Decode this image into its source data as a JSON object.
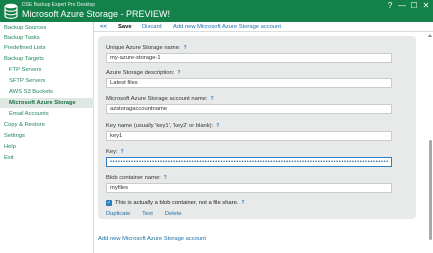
{
  "titlebar": {
    "app_name": "DSE Backup Expert Pro Desktop",
    "page_heading": "Microsoft Azure Storage - PREVIEW!",
    "help_button": "?",
    "minimize_button": "—",
    "maximize_button": "☐",
    "close_button": "✕",
    "accent_color": "#14804a"
  },
  "sidebar": {
    "items": [
      {
        "label": "Backup Sources"
      },
      {
        "label": "Backup Tasks"
      },
      {
        "label": "Predefined Lists"
      },
      {
        "label": "Backup Targets"
      },
      {
        "label": "FTP Servers"
      },
      {
        "label": "SFTP Servers"
      },
      {
        "label": "AWS S3 Buckets"
      },
      {
        "label": "Microsoft Azure Storage"
      },
      {
        "label": "Email Accounts"
      },
      {
        "label": "Copy & Restore"
      },
      {
        "label": "Settings"
      },
      {
        "label": "Help"
      },
      {
        "label": "Exit"
      }
    ]
  },
  "toolbar": {
    "back_label": "<<",
    "save_label": "Save",
    "discard_label": "Discard",
    "add_new_label": "Add new Microsoft Azure Storage account"
  },
  "form": {
    "help_glyph": "?",
    "unique_name_label": "Unique Azure Storage name:",
    "unique_name_value": "my-azure-storage-1",
    "description_label": "Azure Storage description:",
    "description_value": "Latest files",
    "account_name_label": "Microsoft Azure Storage account name:",
    "account_name_value": "azstoragaccountname",
    "key_name_label": "Key name (usually 'key1', 'key2' or blank):",
    "key_name_value": "key1",
    "key_label": "Key:",
    "key_value": "••••••••••••••••••••••••••••••••••••••••••••••••••••••••••••••••••••••••••••••••••••••••••••••••••••••••••",
    "container_label": "Blob container name:",
    "container_value": "myfiles",
    "blob_checkbox_label": "This is actually a blob container, not a file share.",
    "blob_checkbox_checked": true,
    "checkmark_glyph": "✓",
    "duplicate_label": "Duplicate",
    "test_label": "Test",
    "delete_label": "Delete"
  },
  "footer": {
    "add_account_label": "Add new Microsoft Azure Storage account"
  }
}
